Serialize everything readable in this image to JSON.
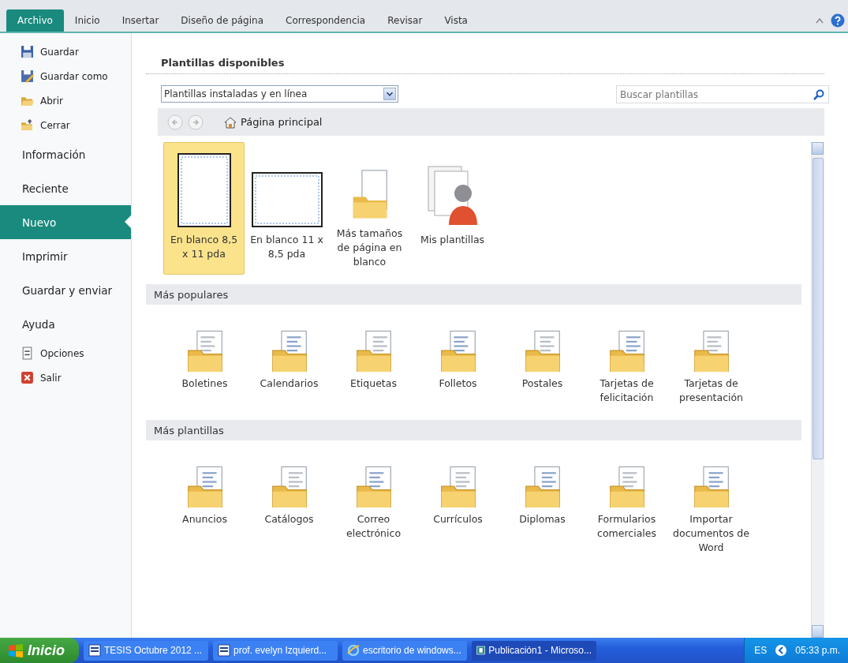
{
  "tabs": [
    {
      "label": "Archivo",
      "selected": true
    },
    {
      "label": "Inicio",
      "selected": false
    },
    {
      "label": "Insertar",
      "selected": false
    },
    {
      "label": "Diseño de página",
      "selected": false
    },
    {
      "label": "Correspondencia",
      "selected": false
    },
    {
      "label": "Revisar",
      "selected": false
    },
    {
      "label": "Vista",
      "selected": false
    }
  ],
  "sidebar": {
    "items": [
      {
        "label": "Guardar",
        "kind": "command",
        "selected": false
      },
      {
        "label": "Guardar como",
        "kind": "command",
        "selected": false
      },
      {
        "label": "Abrir",
        "kind": "command",
        "selected": false
      },
      {
        "label": "Cerrar",
        "kind": "command",
        "selected": false
      },
      {
        "label": "Información",
        "kind": "page",
        "selected": false
      },
      {
        "label": "Reciente",
        "kind": "page",
        "selected": false
      },
      {
        "label": "Nuevo",
        "kind": "page",
        "selected": true
      },
      {
        "label": "Imprimir",
        "kind": "page",
        "selected": false
      },
      {
        "label": "Guardar y enviar",
        "kind": "page",
        "selected": false
      },
      {
        "label": "Ayuda",
        "kind": "page",
        "selected": false
      },
      {
        "label": "Opciones",
        "kind": "command",
        "selected": false
      },
      {
        "label": "Salir",
        "kind": "command",
        "selected": false
      }
    ]
  },
  "templates": {
    "title": "Plantillas disponibles",
    "source": "Plantillas instaladas y en línea",
    "search": {
      "placeholder": "Buscar plantillas"
    },
    "home": "Página principal",
    "blank": [
      {
        "label": "En blanco 8,5 x 11 pda",
        "kind": "portrait",
        "selected": true
      },
      {
        "label": "En blanco 11 x 8,5 pda",
        "kind": "landscape",
        "selected": false
      },
      {
        "label": "Más tamaños de página en blanco",
        "kind": "folder",
        "selected": false
      },
      {
        "label": "Mis plantillas",
        "kind": "user",
        "selected": false
      }
    ],
    "sections": [
      {
        "title": "Más populares",
        "items": [
          "Boletines",
          "Calendarios",
          "Etiquetas",
          "Folletos",
          "Postales",
          "Tarjetas de felicitación",
          "Tarjetas de presentación"
        ]
      },
      {
        "title": "Más plantillas",
        "items": [
          "Anuncios",
          "Catálogos",
          "Correo electrónico",
          "Currículos",
          "Diplomas",
          "Formularios comerciales",
          "Importar documentos de Word"
        ]
      }
    ]
  },
  "taskbar": {
    "start": "Inicio",
    "tasks": [
      {
        "label": "TESIS Octubre 2012 ...",
        "kind": "word",
        "selected": false
      },
      {
        "label": "prof. evelyn Izquierd...",
        "kind": "word",
        "selected": false
      },
      {
        "label": "escritorio de windows...",
        "kind": "browser",
        "selected": false
      },
      {
        "label": "Publicación1 - Microso...",
        "kind": "publisher",
        "selected": true
      }
    ],
    "language": "ES",
    "clock": "05:33 p.m."
  }
}
